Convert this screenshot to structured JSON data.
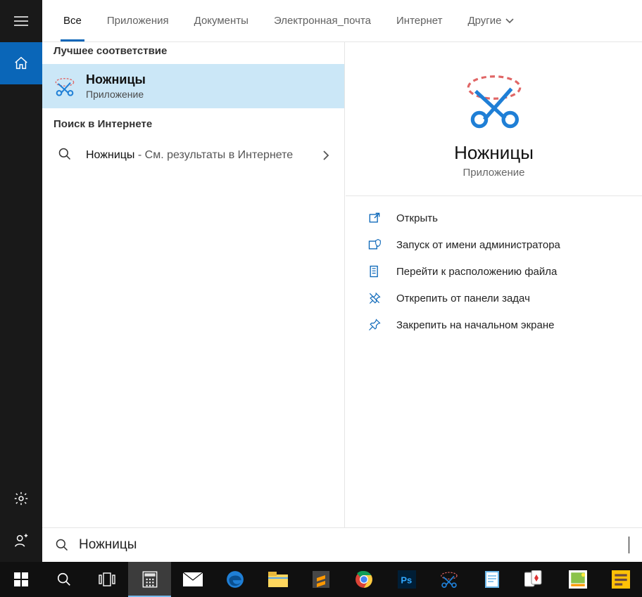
{
  "tabs": {
    "all": "Все",
    "apps": "Приложения",
    "docs": "Документы",
    "email": "Электронная_почта",
    "web": "Интернет",
    "more": "Другие"
  },
  "sections": {
    "best_match": "Лучшее соответствие",
    "web_search": "Поиск в Интернете"
  },
  "best_match_item": {
    "title": "Ножницы",
    "subtitle": "Приложение"
  },
  "web_item": {
    "term": "Ножницы",
    "suffix": " - См. результаты в Интернете"
  },
  "preview": {
    "title": "Ножницы",
    "subtitle": "Приложение"
  },
  "actions": {
    "open": "Открыть",
    "run_admin": "Запуск от имени администратора",
    "file_location": "Перейти к расположению файла",
    "unpin_taskbar": "Открепить от панели задач",
    "pin_start": "Закрепить на начальном экране"
  },
  "search": {
    "value": "Ножницы"
  }
}
